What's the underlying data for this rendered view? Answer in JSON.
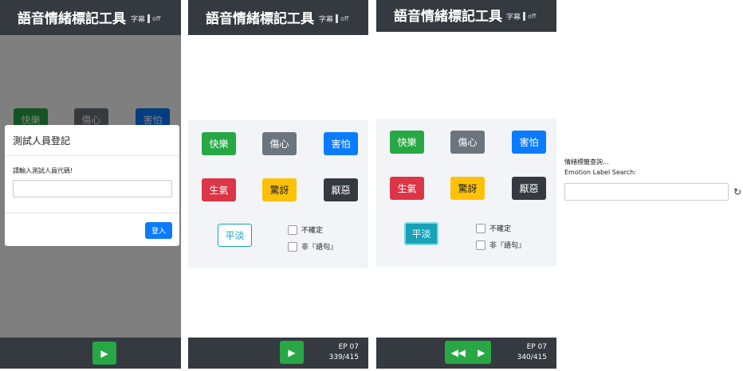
{
  "app": {
    "title": "語音情緒標記工具",
    "subtitle_toggle": "字幕",
    "toggle_state": "off"
  },
  "colors": {
    "header": "#353a40",
    "happy": "#28a745",
    "sad": "#6c757d",
    "fear": "#0b7bff",
    "angry": "#dc3545",
    "surprise": "#ffc107",
    "disgust": "#343a40",
    "calm": "#17a2b8"
  },
  "emotions": {
    "happy": "快樂",
    "sad": "傷心",
    "fear": "害怕",
    "angry": "生氣",
    "surprise": "驚訝",
    "disgust": "厭惡",
    "calm": "平淡"
  },
  "checks": {
    "uncertain": "不確定",
    "not_sentence": "非『語句』"
  },
  "login_modal": {
    "title": "測試人員登記",
    "label": "請輸入測試人員代碼!",
    "input_value": "",
    "submit": "登入"
  },
  "panel2_footer": {
    "episode": "EP 07",
    "progress": "339/415"
  },
  "panel3_footer": {
    "episode": "EP 07",
    "progress": "340/415"
  },
  "search": {
    "label_zh": "情緒標籤查詢...",
    "label_en": "Emotion Label Search:",
    "value": "",
    "reload_icon": "refresh-icon"
  }
}
